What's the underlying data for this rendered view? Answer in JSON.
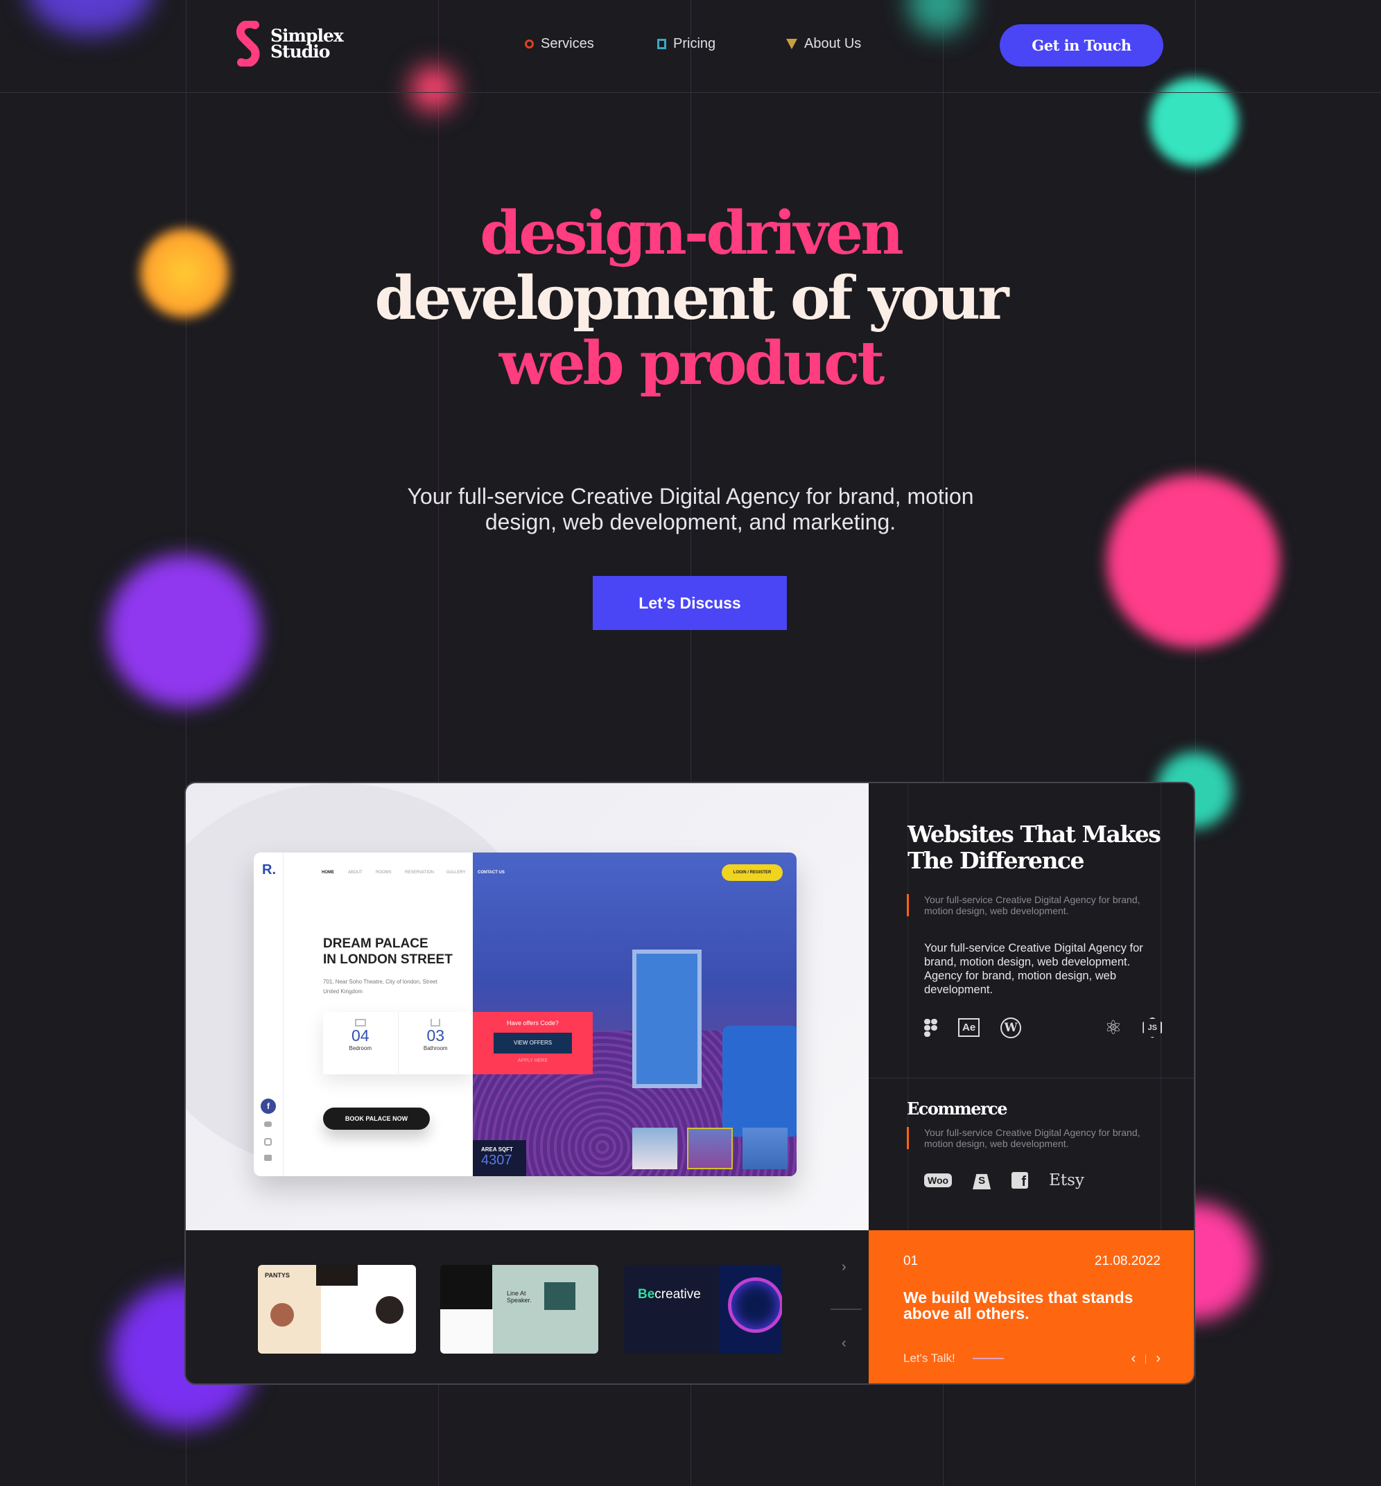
{
  "header": {
    "logo_text_1": "Simplex",
    "logo_text_2": "Studio",
    "nav": [
      {
        "label": "Services",
        "icon": "circle-icon",
        "color": "#e0401e"
      },
      {
        "label": "Pricing",
        "icon": "square-icon",
        "color": "#3aa8c0"
      },
      {
        "label": "About Us",
        "icon": "triangle-icon",
        "color": "#c9a040"
      }
    ],
    "cta": "Get in Touch"
  },
  "hero": {
    "line1": "design-driven",
    "line2": "development of your",
    "line3": "web product",
    "subtitle_1": "Your full-service Creative Digital Agency for brand, motion",
    "subtitle_2": "design, web development, and marketing.",
    "button": "Let’s Discuss"
  },
  "mockup": {
    "logo": "R.",
    "nav": [
      "HOME",
      "ABOUT",
      "ROOMS",
      "RESERVATION",
      "GALLERY",
      "CONTACT US"
    ],
    "login": "LOGIN / REGISTER",
    "title_1": "DREAM PALACE",
    "title_2": "IN LONDON STREET",
    "address_1": "701, Near Soho Theatre, City of london, Street",
    "address_2": "United Kingdom",
    "bedroom_count": "04",
    "bedroom_label": "Bedroom",
    "bathroom_count": "03",
    "bathroom_label": "Bathroom",
    "offer_title": "Have offers Code?",
    "offer_button": "VIEW OFFERS",
    "offer_link": "APPLY HERE",
    "book": "BOOK PALACE NOW",
    "area_label": "AREA SQFT",
    "area_value": "4307"
  },
  "panel": {
    "title_1": "Websites That Makes",
    "title_2": "The Difference",
    "quote": "Your full-service Creative Digital Agency for brand, motion design, web development.",
    "body": "Your full-service Creative Digital Agency for brand, motion design, web development. Agency for brand, motion design, web development.",
    "tools": [
      "figma-icon",
      "after-effects-icon",
      "wordpress-icon",
      "react-icon",
      "nodejs-icon"
    ],
    "ae": "Ae",
    "ecommerce_title": "Ecommerce",
    "ecommerce_quote": "Your full-service Creative Digital Agency for brand, motion design, web development.",
    "woo": "Woo",
    "etsy": "Etsy"
  },
  "thumbs": {
    "t1": "PANTYS",
    "t2": "Line At Speaker.",
    "t3_be": "Be",
    "t3_creative": "creative"
  },
  "slide": {
    "index": "01",
    "date": "21.08.2022",
    "headline": "We build Websites that stands above all others.",
    "link": "Let's Talk!"
  },
  "colors": {
    "accent": "#4a45f5",
    "pink": "#ff3d7f",
    "orange": "#ff6610"
  }
}
